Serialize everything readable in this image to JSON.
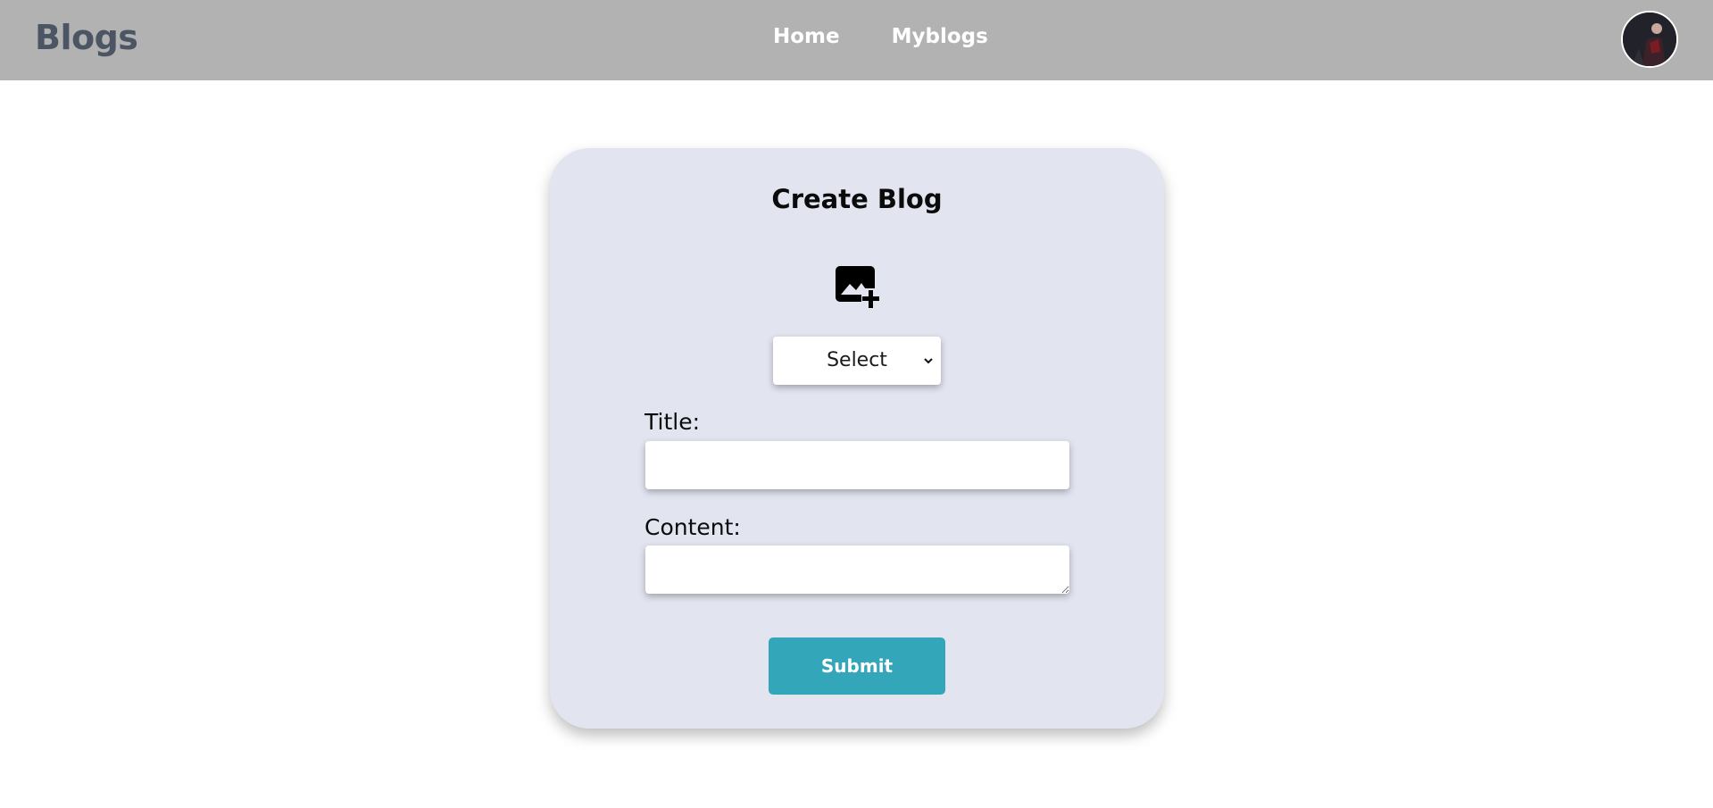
{
  "navbar": {
    "brand": "Blogs",
    "links": [
      {
        "label": "Home"
      },
      {
        "label": "Myblogs"
      }
    ]
  },
  "form": {
    "title": "Create Blog",
    "category_select": {
      "selected": "Select"
    },
    "title_label": "Title:",
    "title_value": "",
    "content_label": "Content:",
    "content_value": "",
    "submit_label": "Submit"
  },
  "colors": {
    "navbar_bg": "#b2b2b2",
    "brand": "#4b5563",
    "card_bg": "#e2e5f0",
    "submit_bg": "#33a6ba"
  },
  "icons": {
    "image_upload": "add-photo-icon",
    "select_chevron": "chevron-down-icon"
  }
}
